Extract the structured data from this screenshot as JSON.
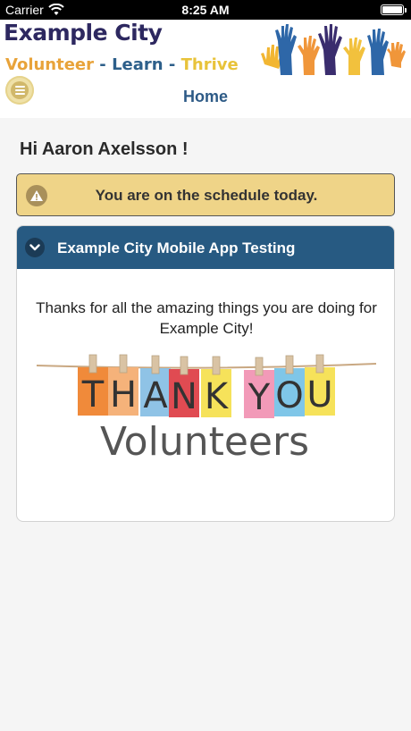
{
  "status_bar": {
    "carrier": "Carrier",
    "time": "8:25 AM"
  },
  "header": {
    "brand_title": "Example City",
    "tagline": {
      "word1": "Volunteer",
      "separator": "-",
      "word2": "Learn",
      "word3": "Thrive"
    },
    "nav_title": "Home",
    "menu_icon": "hamburger-icon",
    "logo_icon": "raised-hands-logo"
  },
  "main": {
    "greeting": "Hi Aaron Axelsson !",
    "alert": {
      "icon": "warning-icon",
      "text": "You are on the schedule today."
    },
    "card": {
      "title": "Example City Mobile App Testing",
      "chevron_icon": "chevron-down-icon",
      "message": "Thanks for all the amazing things you are doing for Example City!",
      "image": {
        "letters": [
          "T",
          "H",
          "A",
          "N",
          "K",
          "Y",
          "O",
          "U"
        ],
        "subtitle": "Volunteers"
      }
    }
  },
  "colors": {
    "brand_navy": "#2d2860",
    "accent_orange": "#e8a33a",
    "accent_blue": "#2d5f8a",
    "header_blue": "#275a82",
    "alert_yellow": "#efd488"
  }
}
